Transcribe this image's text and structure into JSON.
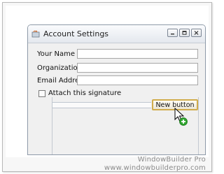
{
  "window": {
    "title": "Account Settings",
    "icon": "java-app-icon",
    "caption_buttons": [
      "minimize-icon",
      "maximize-icon",
      "close-icon"
    ]
  },
  "form": {
    "fields": [
      {
        "label": "Your Name",
        "value": ""
      },
      {
        "label": "Organization",
        "value": ""
      },
      {
        "label": "Email Address",
        "value": ""
      }
    ],
    "checkbox": {
      "label": "Attach this signature",
      "checked": false
    }
  },
  "drag": {
    "button_label": "New button",
    "cursor_icon": "arrow-cursor-icon",
    "badge_icon": "add-plus-icon"
  },
  "watermark": {
    "product": "WindowBuilder Pro",
    "url": "www.windowbuilderpro.com"
  },
  "colors": {
    "selection_border": "#d1ac4c",
    "add_badge": "#2fa52f"
  }
}
